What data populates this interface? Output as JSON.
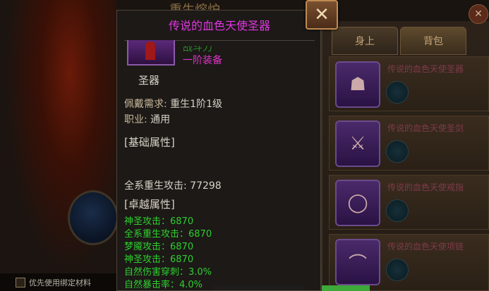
{
  "tooltip": {
    "title": "传说的血色天使圣器",
    "cut_line": "战斗力",
    "grade": "一阶装备",
    "item_type": "圣器",
    "requirement_label": "佩戴需求:",
    "requirement_value": "重生1阶1级",
    "class_label": "职业:",
    "class_value": "通用",
    "base_header": "[基础属性]",
    "base_stat": "全系重生攻击: 77298",
    "excellent_header": "[卓越属性]",
    "excellent_stats": [
      "神圣攻击：6870",
      "全系重生攻击：6870",
      "梦魇攻击：6870",
      "神圣攻击：6870",
      "自然伤害穿刺：3.0%",
      "自然暴击率：4.0%"
    ]
  },
  "background": {
    "title": "重生熔炉",
    "footer_hint": "优先使用绑定材料"
  },
  "tabs": {
    "body": "身上",
    "bag": "背包"
  },
  "items": [
    {
      "name": "传说的血色天使圣器"
    },
    {
      "name": "传说的血色天使圣剑"
    },
    {
      "name": "传说的血色天使戒指"
    },
    {
      "name": "传说的血色天使项链"
    }
  ],
  "colors": {
    "legendary": "#e036e0",
    "excellent": "#2fcf2f"
  },
  "icons": {
    "close": "close-x-icon"
  }
}
